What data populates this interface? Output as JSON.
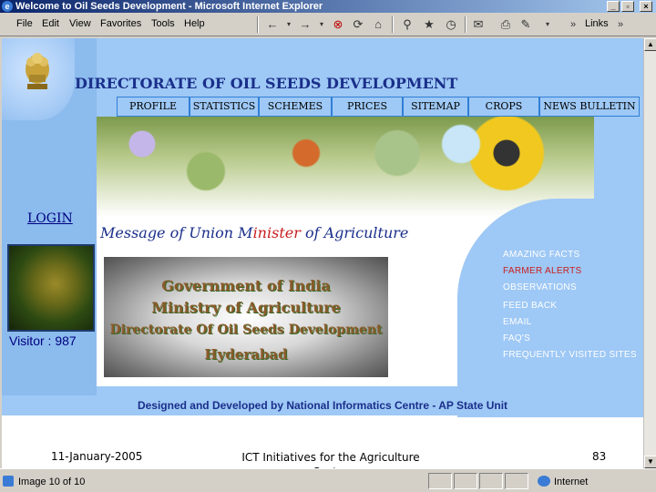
{
  "window": {
    "title": "Welcome to Oil Seeds Development - Microsoft Internet Explorer",
    "minimize": "_",
    "maximize": "▫",
    "close": "×"
  },
  "menu": [
    "File",
    "Edit",
    "View",
    "Favorites",
    "Tools",
    "Help"
  ],
  "toolbar": {
    "back_icon": "back-arrow-icon",
    "forward_icon": "forward-arrow-icon",
    "links_label": "Links",
    "chevron": "»"
  },
  "site": {
    "title": "DIRECTORATE OF OIL SEEDS DEVELOPMENT",
    "nav": [
      "PROFILE",
      "STATISTICS",
      "SCHEMES",
      "PRICES",
      "SITEMAP",
      "CROPS",
      "NEWS BULLETIN"
    ],
    "login": "LOGIN",
    "visitor": "Visitor : 987",
    "message_pre": "Message of Union M",
    "message_red": "inister",
    "message_post": " of Agriculture",
    "gov_lines": [
      "Government of India",
      "Ministry of Agriculture",
      "Directorate Of Oil Seeds Development",
      "Hyderabad"
    ],
    "side_links": [
      "AMAZING FACTS",
      "FARMER ALERTS",
      "OBSERVATIONS",
      "FEED BACK",
      "EMAIL",
      "FAQ'S",
      "FREQUENTLY VISITED SITES"
    ],
    "footer": "Designed and Developed by National Informatics Centre - AP State Unit"
  },
  "slide_footer": {
    "date": "11-January-2005",
    "center": "ICT Initiatives for the Agriculture Sector",
    "page": "83"
  },
  "status": {
    "text": "Image 10 of 10",
    "zone": "Internet"
  }
}
